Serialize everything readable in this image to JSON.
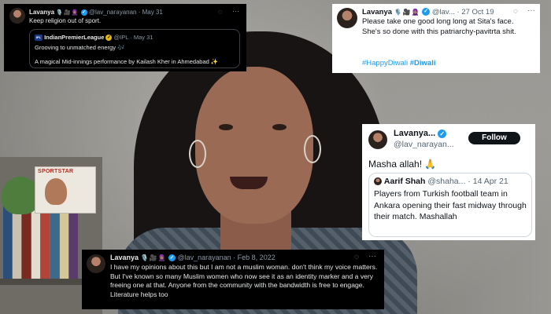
{
  "colors": {
    "accent": "#1d9bf0",
    "dark_card": "#000000",
    "light_card": "#ffffff"
  },
  "background": {
    "poster_text": "SPORTSTAR"
  },
  "tweets": [
    {
      "name": "Lavanya",
      "emojis": "🎙️🎥🧕🏽",
      "handle": "@lav_narayanan",
      "date": "· May 31",
      "text": "Keep religion out of sport.",
      "quote": {
        "logo": "IPL",
        "name": "IndianPremierLeague",
        "handle": "@IPL",
        "date": "· May 31",
        "line1": "Grooving to unmatched energy 🎶",
        "line2": "A magical Mid-innings performance by Kailash Kher in Ahmedabad ✨"
      }
    },
    {
      "name": "Lavanya",
      "emojis": "🎙️🎥🧕🏽",
      "handle": "@lav...",
      "date": "· 27 Oct 19",
      "text": "Please take one good long long at Sita's face. She's so done with this patriarchy-pavitrta shit.",
      "tags": [
        "#HappyDiwali",
        "#Diwali"
      ]
    },
    {
      "name": "Lavanya...",
      "handle": "@lav_narayan...",
      "follow": "Follow",
      "text": "Masha allah! 🙏",
      "quote": {
        "name": "Aarif Shah",
        "handle": "@shaha...",
        "date": "· 14 Apr 21",
        "text": "Players from Turkish football team in Ankara opening their fast midway through their match. Mashallah"
      }
    },
    {
      "name": "Lavanya",
      "emojis": "🎙️🎥🧕🏽",
      "handle": "@lav_narayanan",
      "date": "· Feb 8, 2022",
      "text": "I have my opinions about this but I am not a muslim woman. don't think my voice matters. But I've known so many Muslim women who now see it as an identity marker and a very freeing one at that. Anyone from the community with the bandwidth is free to engage. Literature helps too"
    }
  ]
}
